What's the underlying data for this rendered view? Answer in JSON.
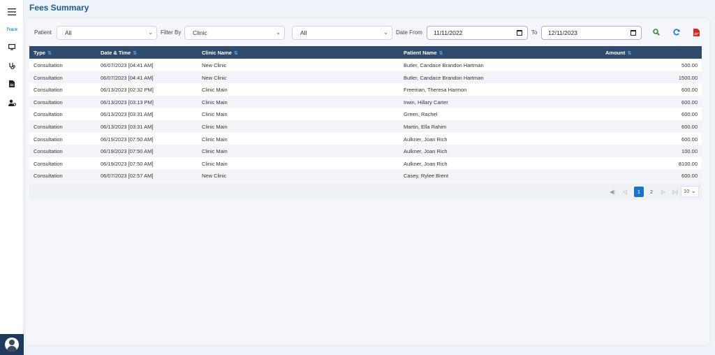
{
  "page": {
    "title": "Fees Summary"
  },
  "sidebar": {
    "logo_text": "Track",
    "items": [
      {
        "icon": "hamburger-menu-icon"
      },
      {
        "icon": "monitor-icon"
      },
      {
        "icon": "stethoscope-icon"
      },
      {
        "icon": "document-icon"
      },
      {
        "icon": "user-settings-icon"
      }
    ]
  },
  "filters": {
    "patient_label": "Patient",
    "patient_value": "All",
    "filter_by_label": "Filter By",
    "filter_by_value": "Clinic",
    "filter_value": "All",
    "date_from_label": "Date From",
    "date_from_value": "11/11/2022",
    "to_label": "To",
    "date_to_value": "12/11/2023"
  },
  "actions": {
    "search_color": "#2e8b2e",
    "refresh_color": "#1a6fd1",
    "pdf_color": "#e02424"
  },
  "table": {
    "columns": [
      "Type",
      "Date & Time",
      "Clinic Name",
      "Patient Name",
      "Amount"
    ],
    "rows": [
      [
        "Consultation",
        "06/07/2023 [04:41 AM]",
        "New Clinic",
        "Butler, Candace Brandon Hartman",
        "500.00"
      ],
      [
        "Consultation",
        "06/07/2023 [04:41 AM]",
        "New Clinic",
        "Butler, Candace Brandon Hartman",
        "1500.00"
      ],
      [
        "Consultation",
        "06/13/2023 [02:32 PM]",
        "Clinic Main",
        "Freeman, Theresa Harmon",
        "600.00"
      ],
      [
        "Consultation",
        "06/13/2023 [03:13 PM]",
        "Clinic Main",
        "Irwin, Hillary Carter",
        "600.00"
      ],
      [
        "Consultation",
        "06/13/2023 [03:31 AM]",
        "Clinic Main",
        "Green, Rachel",
        "600.00"
      ],
      [
        "Consultation",
        "06/13/2023 [03:31 AM]",
        "Clinic Main",
        "Martin, Ella Rahim",
        "600.00"
      ],
      [
        "Consultation",
        "06/19/2023 [07:50 AM]",
        "Clinic Main",
        "Aulkner, Joan Rich",
        "600.00"
      ],
      [
        "Consultation",
        "06/19/2023 [07:50 AM]",
        "Clinic Main",
        "Aulkner, Joan Rich",
        "100.00"
      ],
      [
        "Consultation",
        "06/19/2023 [07:50 AM]",
        "Clinic Main",
        "Aulkner, Joan Rich",
        "8100.00"
      ],
      [
        "Consultation",
        "06/07/2023 [02:57 AM]",
        "New Clinic",
        "Casey, Rylee Brent",
        "600.00"
      ]
    ]
  },
  "pagination": {
    "pages": [
      "1",
      "2"
    ],
    "current_page": "1",
    "page_size": "10"
  },
  "colors": {
    "header_bg": "#2f4a6b",
    "accent": "#1a73c8",
    "title": "#1e5a8e"
  }
}
